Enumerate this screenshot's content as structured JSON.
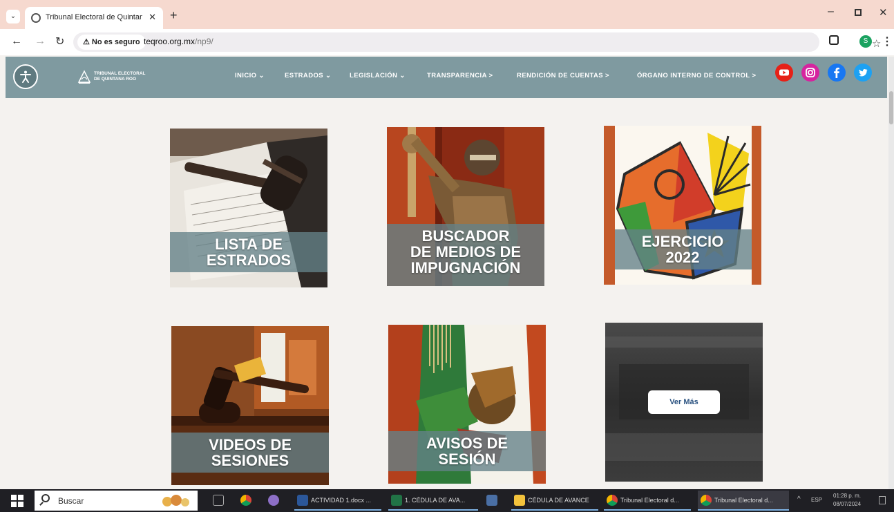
{
  "browser": {
    "tab_title": "Tribunal Electoral de Quintana R",
    "security_chip": "No es seguro",
    "url_host": "teqroo.org.mx",
    "url_path": "/np9/",
    "profile_initial": "S"
  },
  "site": {
    "logo_line1": "TRIBUNAL ELECTORAL",
    "logo_line2": "DE QUINTANA ROO",
    "nav": [
      {
        "label": "INICIO",
        "icon": "chevron-down-icon"
      },
      {
        "label": "ESTRADOS",
        "icon": "chevron-down-icon"
      },
      {
        "label": "LEGISLACIÓN",
        "icon": "chevron-down-icon"
      },
      {
        "label": "TRANSPARENCIA >",
        "icon": ""
      },
      {
        "label": "RENDICIÓN DE CUENTAS >",
        "icon": ""
      },
      {
        "label": "ÓRGANO INTERNO DE CONTROL >",
        "icon": ""
      }
    ],
    "social": [
      "youtube-icon",
      "instagram-icon",
      "facebook-icon",
      "twitter-icon"
    ]
  },
  "tiles": [
    {
      "line1": "LISTA DE",
      "line2": "ESTRADOS",
      "line3": ""
    },
    {
      "line1": "BUSCADOR",
      "line2": "DE MEDIOS DE",
      "line3": "IMPUGNACIÓN"
    },
    {
      "line1": "EJERCICIO",
      "line2": "2022",
      "line3": ""
    },
    {
      "line1": "VIDEOS DE",
      "line2": "SESIONES",
      "line3": ""
    },
    {
      "line1": "AVISOS DE",
      "line2": "SESIÓN",
      "line3": ""
    },
    {
      "button": "Ver Más"
    }
  ],
  "taskbar": {
    "search": "Buscar",
    "items": [
      {
        "label": "ACTIVIDAD 1.docx ..."
      },
      {
        "label": "1. CÉDULA DE AVA..."
      },
      {
        "label": "CÉDULA DE AVANCE"
      },
      {
        "label": "Tribunal Electoral d..."
      },
      {
        "label": "Tribunal Electoral d..."
      }
    ],
    "lang": "ESP",
    "time": "01:28 p. m.",
    "date": "08/07/2024"
  },
  "colors": {
    "tabstrip": "#f6d9cf",
    "header": "#7f9aa0",
    "tile_band": "#648288",
    "page_bg": "#f4f2ef",
    "taskbar": "#1f1f24"
  }
}
